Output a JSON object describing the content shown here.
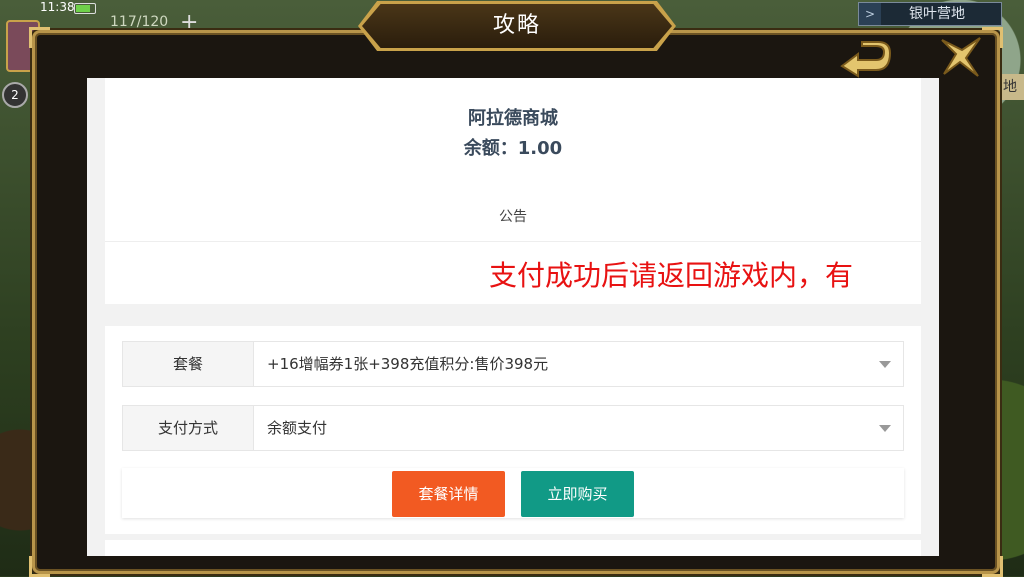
{
  "hud": {
    "time": "11:38",
    "stamina": "117/120",
    "plus": "+",
    "level": "2",
    "location": "银叶营地",
    "location_arrow": ">",
    "side_hint": "地"
  },
  "dialog": {
    "title": "攻略",
    "back_icon": "back-arrow-icon",
    "close_icon": "close-x-icon"
  },
  "shop": {
    "name": "阿拉德商城",
    "balance": "余额：1.00",
    "notice_title": "公告",
    "notice_scroll": "支付成功后请返回游戏内，有"
  },
  "form": {
    "package_label": "套餐",
    "package_value": "+16增幅券1张+398充值积分:售价398元",
    "payment_label": "支付方式",
    "payment_value": "余额支付"
  },
  "buttons": {
    "detail": "套餐详情",
    "buy": "立即购买"
  },
  "colors": {
    "frame_gold": "#b8954a",
    "notice_red": "#e81212",
    "detail_orange": "#f25a22",
    "buy_teal": "#119a86"
  }
}
